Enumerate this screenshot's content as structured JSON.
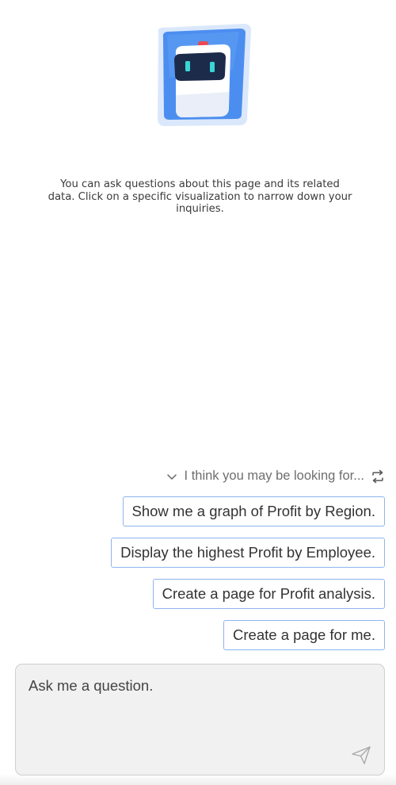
{
  "assistant": {
    "logo_icon": "robot-assistant-icon",
    "intro_text": "You can ask questions about this page and its related data. Click on a specific visualization to narrow down your inquiries."
  },
  "suggestions": {
    "header_label": "I think you may be looking for...",
    "collapse_icon": "chevron-down-icon",
    "refresh_icon": "refresh-icon",
    "items": [
      {
        "label": "Show me a graph of Profit by Region."
      },
      {
        "label": "Display the highest Profit by Employee."
      },
      {
        "label": "Create a page for Profit analysis."
      },
      {
        "label": "Create a page for me."
      }
    ]
  },
  "composer": {
    "placeholder": "Ask me a question.",
    "value": "",
    "send_icon": "send-icon"
  },
  "colors": {
    "chip_border": "#8fb4f0",
    "logo_blue": "#4c8ef0",
    "composer_bg": "#f1f1f2"
  }
}
